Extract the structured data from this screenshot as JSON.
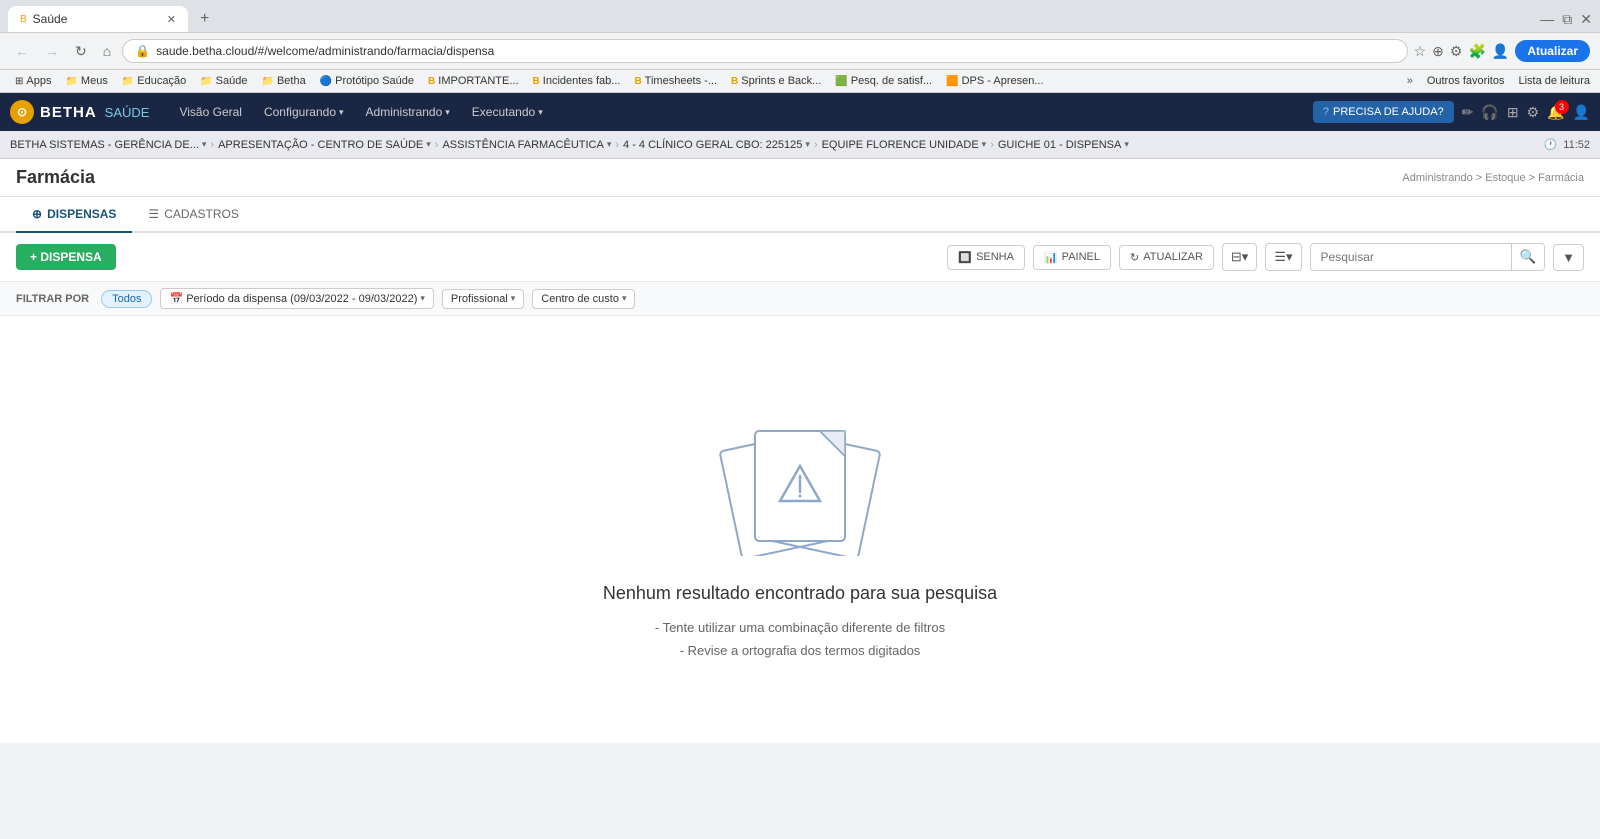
{
  "browser": {
    "tab_title": "Saúde",
    "tab_favicon": "B",
    "url": "saude.betha.cloud/#/welcome/administrando/farmacia/dispensa",
    "update_btn": "Atualizar"
  },
  "bookmarks": {
    "items": [
      {
        "label": "Apps",
        "icon": "⊞"
      },
      {
        "label": "Meus",
        "icon": "📁"
      },
      {
        "label": "Educação",
        "icon": "📁"
      },
      {
        "label": "Saúde",
        "icon": "📁"
      },
      {
        "label": "Betha",
        "icon": "📁"
      },
      {
        "label": "Protótipo Saúde",
        "icon": "🔵"
      },
      {
        "label": "IMPORTANTE...",
        "icon": "B"
      },
      {
        "label": "Incidentes fab...",
        "icon": "B"
      },
      {
        "label": "Timesheets -...",
        "icon": "B"
      },
      {
        "label": "Sprints e Back...",
        "icon": "B"
      },
      {
        "label": "Pesq. de satisf...",
        "icon": "🟩"
      },
      {
        "label": "DPS - Apresen...",
        "icon": "🟧"
      }
    ],
    "more": "»",
    "outros_favoritos": "Outros favoritos",
    "lista_leitura": "Lista de leitura"
  },
  "app": {
    "logo_letter": "B",
    "logo_name": "BETHA",
    "module_name": "SAÚDE",
    "nav_items": [
      {
        "label": "Visão Geral",
        "has_dropdown": false
      },
      {
        "label": "Configurando",
        "has_dropdown": true
      },
      {
        "label": "Administrando",
        "has_dropdown": true
      },
      {
        "label": "Executando",
        "has_dropdown": true
      }
    ],
    "help_btn": "PRECISA DE AJUDA?",
    "notification_count": "3"
  },
  "context_bar": {
    "items": [
      {
        "label": "BETHA SISTEMAS - GERÊNCIA DE..."
      },
      {
        "label": "APRESENTAÇÃO - CENTRO DE SAÚDE"
      },
      {
        "label": "ASSISTÊNCIA FARMACÊUTICA"
      },
      {
        "label": "4 - 4 CLÍNICO GERAL CBO: 225125"
      },
      {
        "label": "EQUIPE FLORENCE UNIDADE"
      },
      {
        "label": "GUICHE 01 - DISPENSA"
      }
    ],
    "time": "11:52"
  },
  "page": {
    "title": "Farmácia",
    "breadcrumb": "Administrando > Estoque > Farmácia"
  },
  "tabs": [
    {
      "label": "DISPENSAS",
      "icon": "⊕",
      "active": true
    },
    {
      "label": "CADASTROS",
      "icon": "☰",
      "active": false
    }
  ],
  "toolbar": {
    "add_btn": "+ DISPENSA",
    "senha_btn": "SENHA",
    "painel_btn": "PAINEL",
    "atualizar_btn": "ATUALIZAR",
    "search_placeholder": "Pesquisar"
  },
  "filter_bar": {
    "label": "FILTRAR POR",
    "active_filter": "Todos",
    "period_filter": "Período da dispensa (09/03/2022 - 09/03/2022)",
    "profissional_filter": "Profissional",
    "centro_custo_filter": "Centro de custo"
  },
  "empty_state": {
    "title": "Nenhum resultado encontrado para sua pesquisa",
    "hint1": "- Tente utilizar uma combinação diferente de filtros",
    "hint2": "- Revise a ortografia dos termos digitados"
  }
}
